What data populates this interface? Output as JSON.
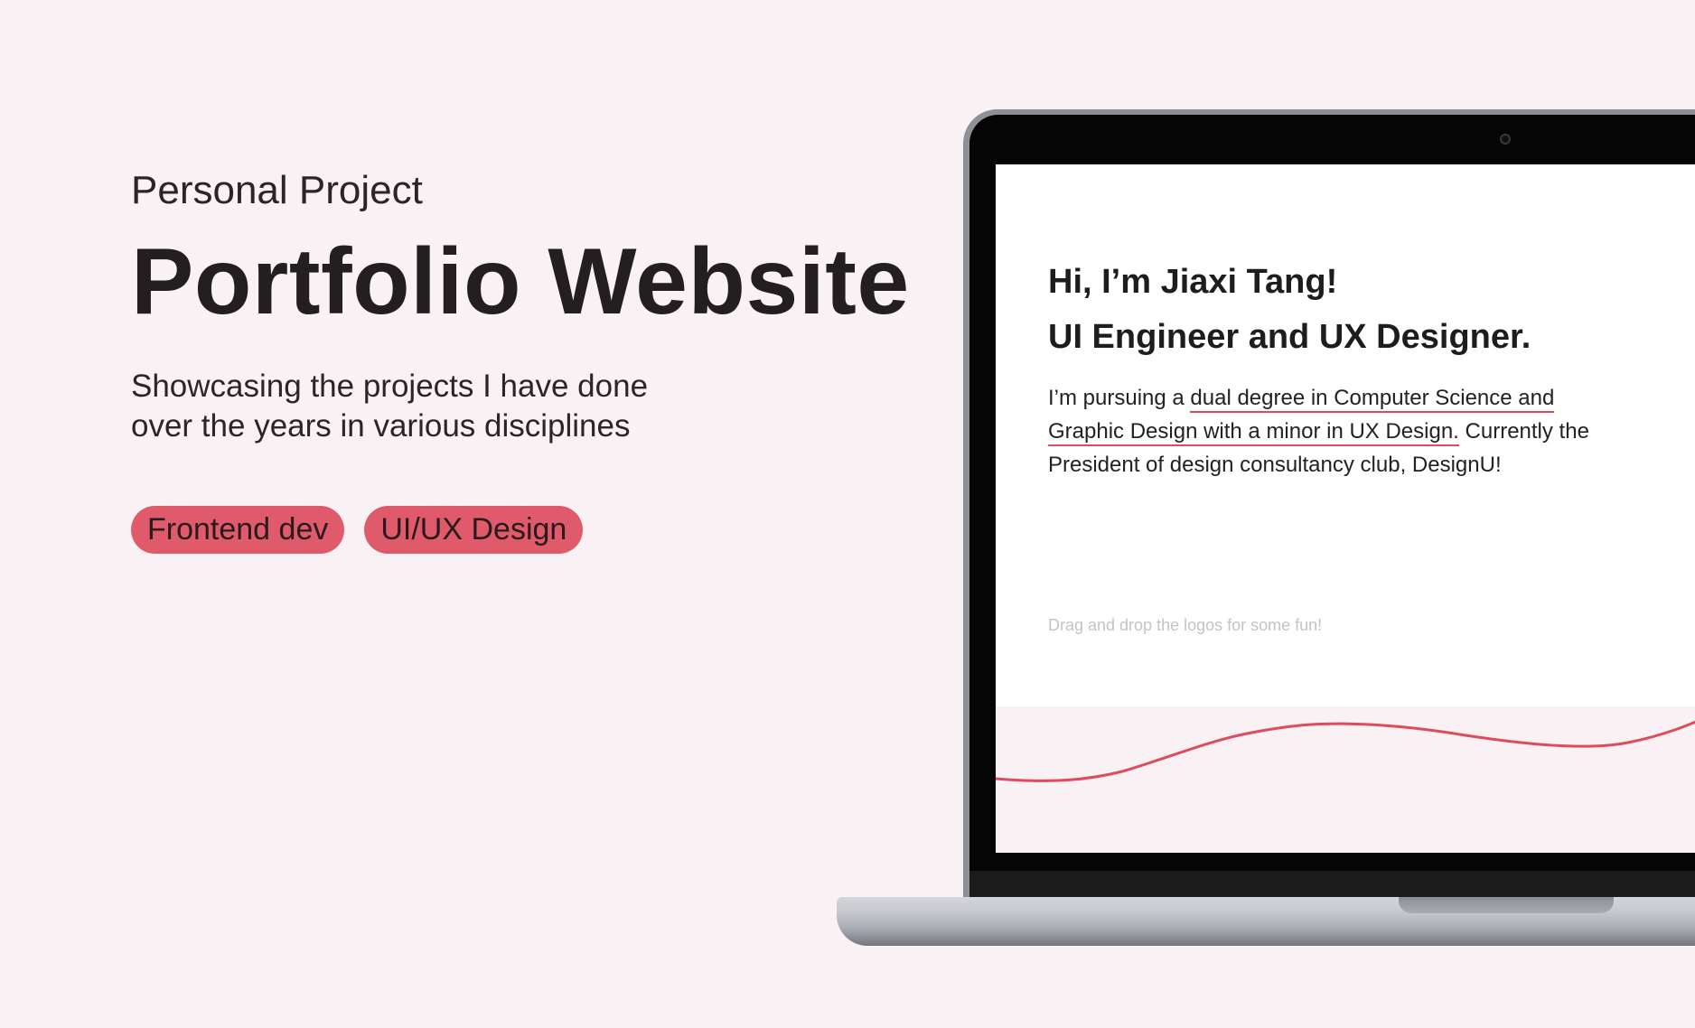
{
  "left": {
    "eyebrow": "Personal Project",
    "title": "Portfolio Website",
    "subtitle_lines": [
      "Showcasing the projects I have done",
      "over the years in various disciplines"
    ],
    "tags": [
      "Frontend dev",
      "UI/UX Design"
    ]
  },
  "screen": {
    "heading_lines": [
      "Hi, I’m Jiaxi Tang!",
      "UI Engineer and UX Designer."
    ],
    "body": {
      "l1_a": "I’m pursuing a ",
      "l1_b": "dual degree in Computer Science and",
      "l2_a": "Graphic Design with a minor in UX Design.",
      "l2_b": " Currently the",
      "l3": "President of design consultancy club, DesignU!"
    },
    "hint": "Drag and drop the logos for some fun!"
  },
  "colors": {
    "background": "#f9f1f3",
    "accent": "#df5a6a",
    "text": "#231f20"
  }
}
